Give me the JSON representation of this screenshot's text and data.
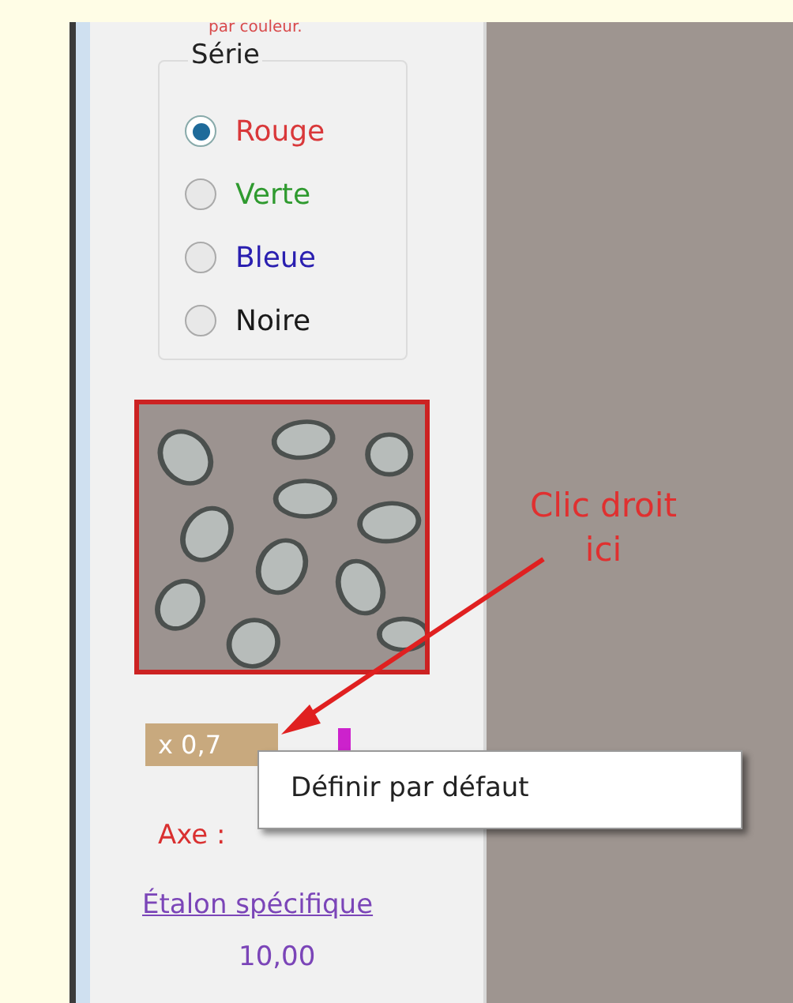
{
  "panel": {
    "hint": "par couleur.",
    "series_group": {
      "title": "Série",
      "options": [
        {
          "label": "Rouge",
          "selected": true,
          "color": "#d9383a"
        },
        {
          "label": "Verte",
          "selected": false,
          "color": "#2f9a2f"
        },
        {
          "label": "Bleue",
          "selected": false,
          "color": "#2a1fb0"
        },
        {
          "label": "Noire",
          "selected": false,
          "color": "#1a1a1a"
        }
      ]
    },
    "scale_field": {
      "value": "x 0,7"
    },
    "axis_label": "Axe :",
    "calibration_link": "Étalon spécifique",
    "calibration_value": "10,00"
  },
  "annotation": {
    "text": "Clic droit",
    "text_2": "ici"
  },
  "context_menu": {
    "items": [
      "Définir par défaut"
    ]
  }
}
